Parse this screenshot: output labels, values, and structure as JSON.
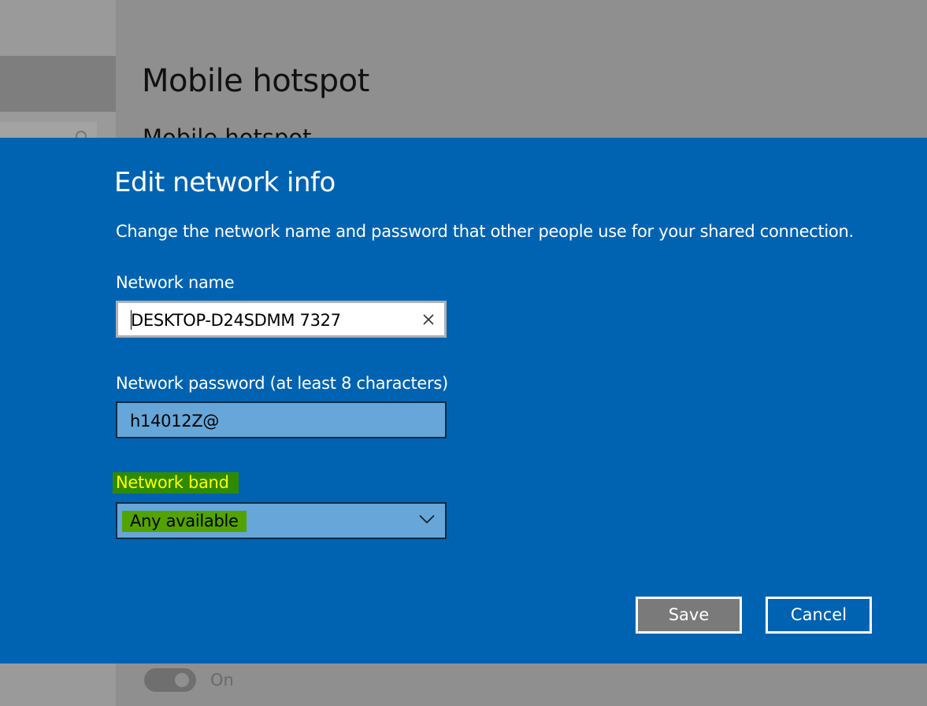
{
  "background": {
    "page_title": "Mobile hotspot",
    "subheading": "Mobile hotspot",
    "toggle_label": "On"
  },
  "dialog": {
    "title": "Edit network info",
    "description": "Change the network name and password that other people use for your shared connection.",
    "network_name": {
      "label": "Network name",
      "value": "DESKTOP-D24SDMM 7327"
    },
    "network_password": {
      "label": "Network password (at least 8 characters)",
      "value": "h14012Z@"
    },
    "network_band": {
      "label": "Network band",
      "selected": "Any available"
    },
    "save_label": "Save",
    "cancel_label": "Cancel"
  },
  "colors": {
    "dialog_bg": "#0063b1",
    "highlight_label_text": "#ffff00",
    "highlight_label_bg": "#2e8b00",
    "highlight_value_bg": "#52a300"
  }
}
